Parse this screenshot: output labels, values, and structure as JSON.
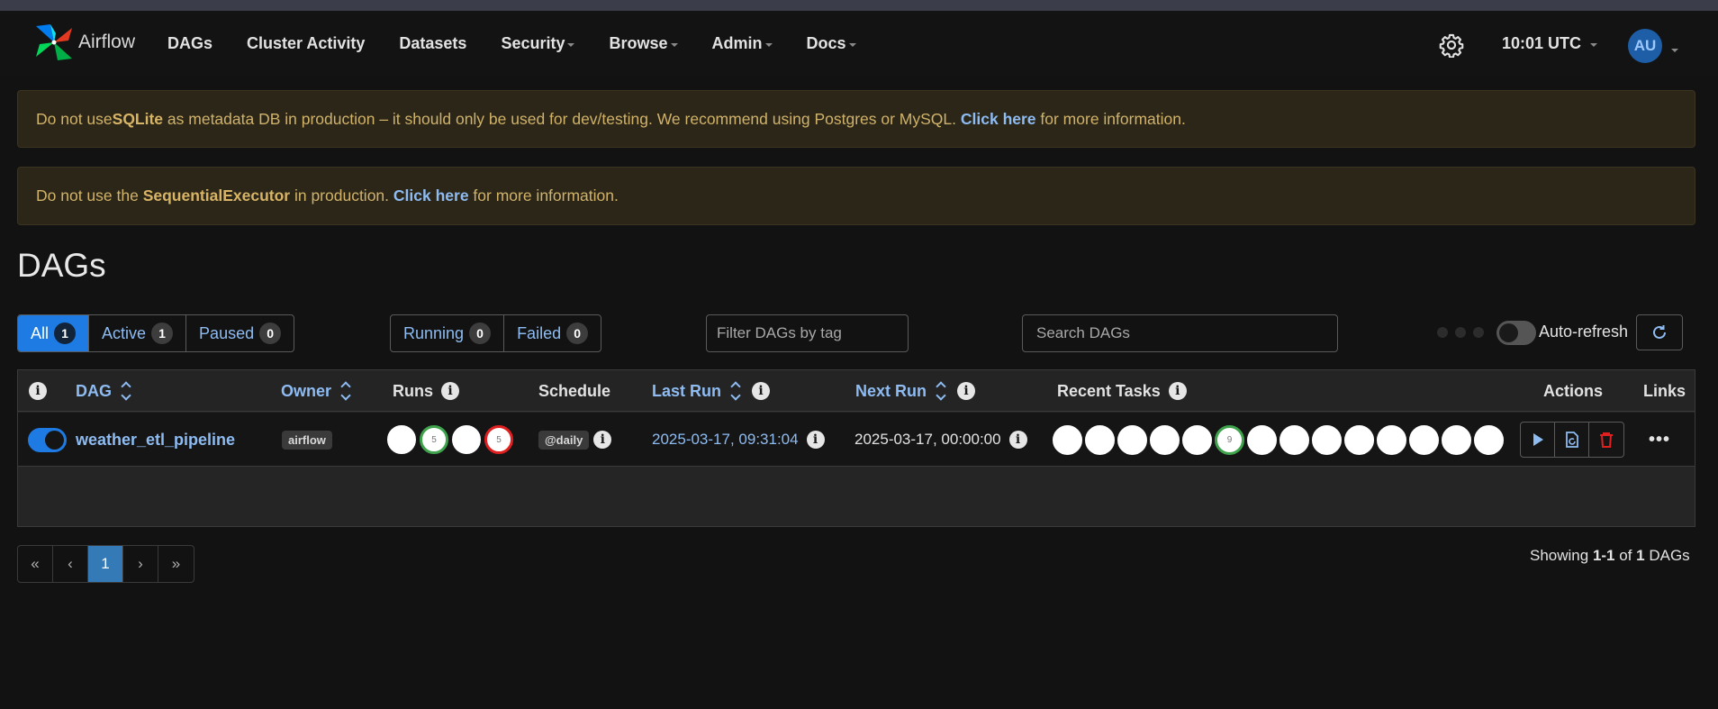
{
  "app": {
    "name": "Airflow"
  },
  "nav": {
    "items": [
      {
        "label": "DAGs",
        "caret": false
      },
      {
        "label": "Cluster Activity",
        "caret": false
      },
      {
        "label": "Datasets",
        "caret": false
      },
      {
        "label": "Security",
        "caret": true
      },
      {
        "label": "Browse",
        "caret": true
      },
      {
        "label": "Admin",
        "caret": true
      },
      {
        "label": "Docs",
        "caret": true
      }
    ],
    "clock": "10:01 UTC",
    "avatar": "AU"
  },
  "alerts": {
    "sqlite": {
      "pre": "Do not use ",
      "bold": "SQLite",
      "mid": " as metadata DB in production – it should only be used for dev/testing. We recommend using Postgres or MySQL. ",
      "link": "Click here",
      "post": " for more information."
    },
    "executor": {
      "pre": "Do not use the ",
      "bold": "SequentialExecutor",
      "mid": " in production. ",
      "link": "Click here",
      "post": " for more information."
    }
  },
  "page": {
    "title": "DAGs"
  },
  "filters": {
    "all": {
      "label": "All",
      "count": "1"
    },
    "active": {
      "label": "Active",
      "count": "1"
    },
    "paused": {
      "label": "Paused",
      "count": "0"
    },
    "running": {
      "label": "Running",
      "count": "0"
    },
    "failed": {
      "label": "Failed",
      "count": "0"
    },
    "tag_placeholder": "Filter DAGs by tag",
    "search_placeholder": "Search DAGs",
    "auto_refresh": "Auto-refresh",
    "auto_refresh_on": false
  },
  "table": {
    "headers": {
      "dag": "DAG",
      "owner": "Owner",
      "runs": "Runs",
      "schedule": "Schedule",
      "last_run": "Last Run",
      "next_run": "Next Run",
      "recent_tasks": "Recent Tasks",
      "actions": "Actions",
      "links": "Links"
    },
    "rows": [
      {
        "paused": false,
        "dag_id": "weather_etl_pipeline",
        "owner": "airflow",
        "runs": [
          {
            "state": "queued",
            "count": ""
          },
          {
            "state": "success",
            "count": "5"
          },
          {
            "state": "running",
            "count": ""
          },
          {
            "state": "failed",
            "count": "5"
          }
        ],
        "schedule": "@daily",
        "last_run": "2025-03-17, 09:31:04",
        "next_run": "2025-03-17, 00:00:00",
        "recent_tasks": [
          "",
          "",
          "",
          "",
          "",
          "9",
          "",
          "",
          "",
          "",
          "",
          "",
          "",
          ""
        ],
        "recent_task_highlight_index": 5
      }
    ]
  },
  "pagination": {
    "first": "«",
    "prev": "‹",
    "current": "1",
    "next": "›",
    "last": "»"
  },
  "footer": {
    "showing_pre": "Showing ",
    "range": "1-1",
    "of": " of ",
    "total": "1",
    "suffix": " DAGs"
  },
  "colors": {
    "accent": "#1d7be3",
    "link": "#8ebcf2",
    "success": "#3fa34d",
    "failed": "#e02020",
    "warning_bg": "#2b2617"
  }
}
